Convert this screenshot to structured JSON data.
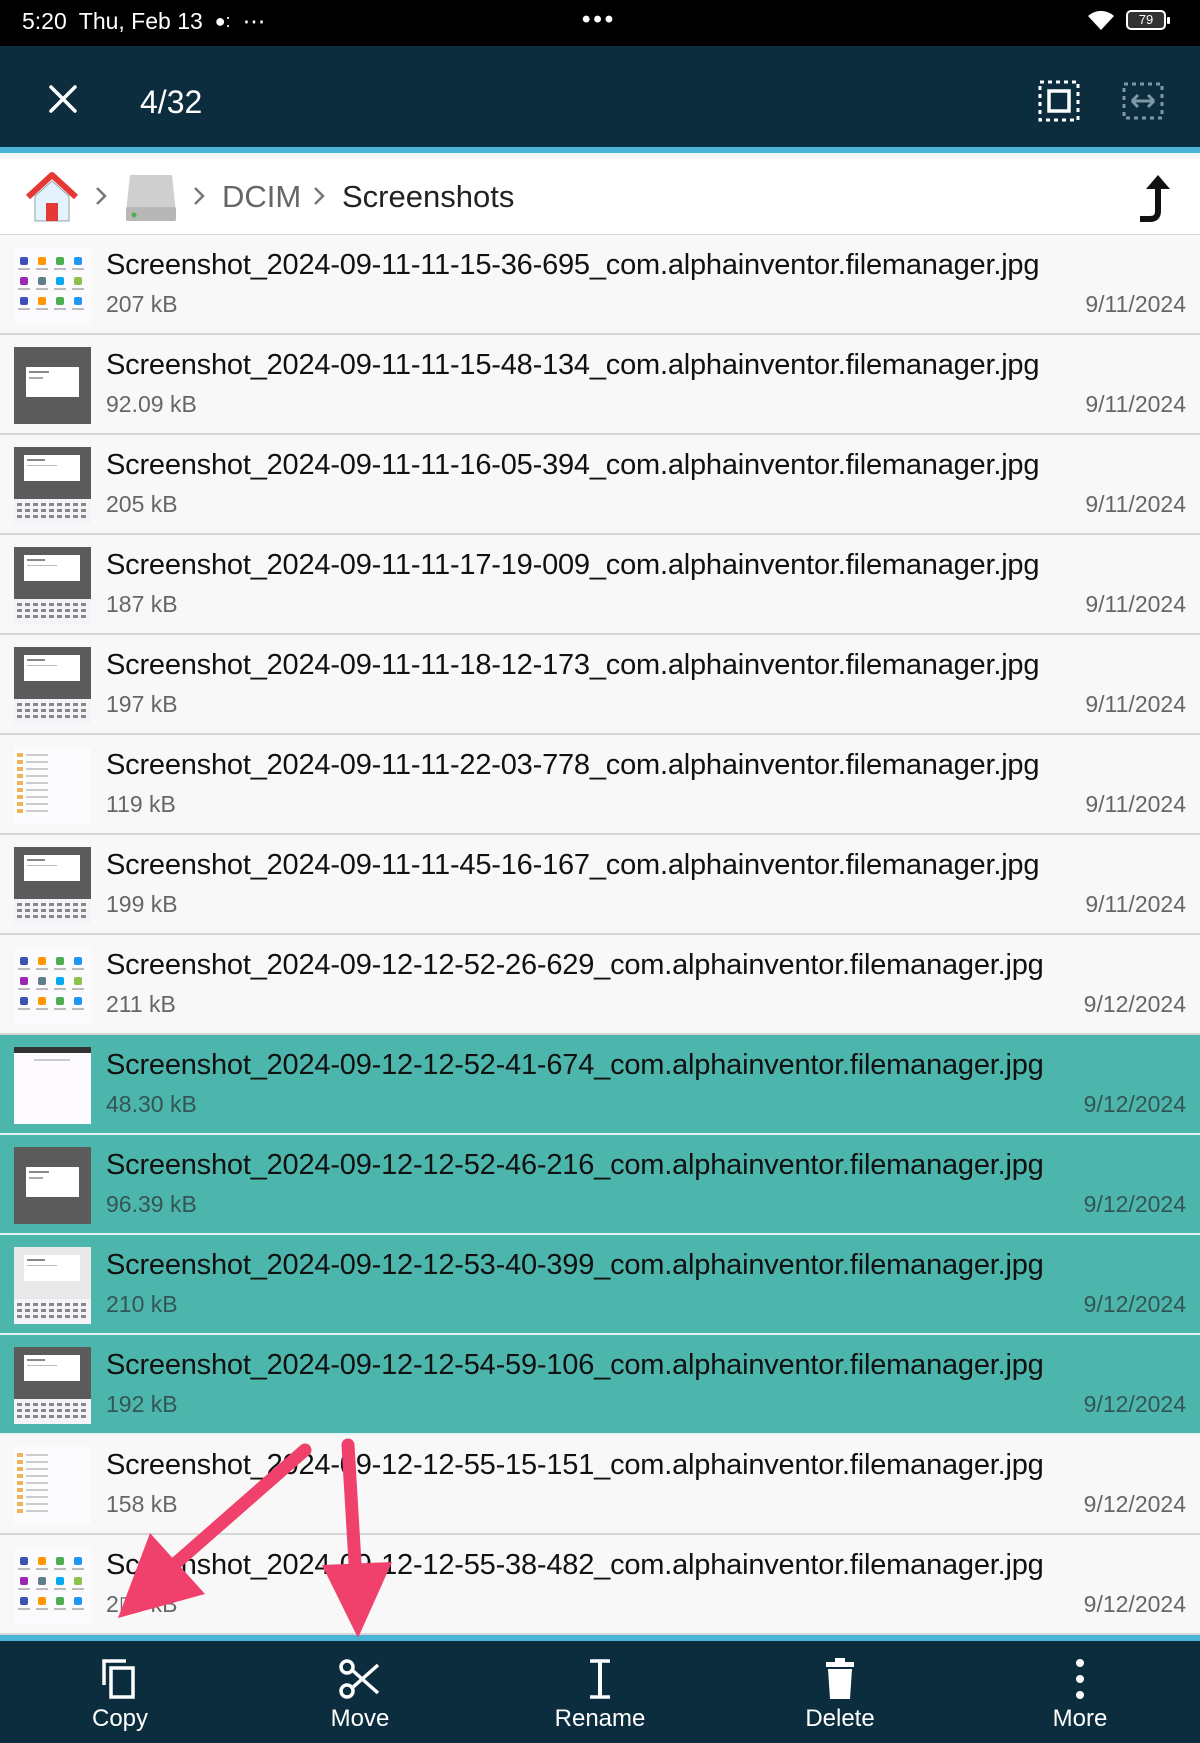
{
  "status_bar": {
    "time": "5:20",
    "date": "Thu, Feb 13",
    "extra": "⋯",
    "center_dots": "•••",
    "battery": "79"
  },
  "toolbar": {
    "selection_count": "4/32",
    "close_icon": "close-icon",
    "select_all_icon": "select-all-icon",
    "select_range_icon": "select-range-icon"
  },
  "breadcrumb": {
    "home_icon": "home-icon",
    "storage_icon": "storage-icon",
    "folder1": "DCIM",
    "folder2": "Screenshots",
    "up_icon": "up-arrow-icon"
  },
  "files": [
    {
      "name": "Screenshot_2024-09-11-11-15-36-695_com.alphainventor.filemanager.jpg",
      "size": "207 kB",
      "date": "9/11/2024",
      "selected": false,
      "thumb": "grid"
    },
    {
      "name": "Screenshot_2024-09-11-11-15-48-134_com.alphainventor.filemanager.jpg",
      "size": "92.09 kB",
      "date": "9/11/2024",
      "selected": false,
      "thumb": "dialog"
    },
    {
      "name": "Screenshot_2024-09-11-11-16-05-394_com.alphainventor.filemanager.jpg",
      "size": "205 kB",
      "date": "9/11/2024",
      "selected": false,
      "thumb": "keyboard"
    },
    {
      "name": "Screenshot_2024-09-11-11-17-19-009_com.alphainventor.filemanager.jpg",
      "size": "187 kB",
      "date": "9/11/2024",
      "selected": false,
      "thumb": "keyboard"
    },
    {
      "name": "Screenshot_2024-09-11-11-18-12-173_com.alphainventor.filemanager.jpg",
      "size": "197 kB",
      "date": "9/11/2024",
      "selected": false,
      "thumb": "keyboard"
    },
    {
      "name": "Screenshot_2024-09-11-11-22-03-778_com.alphainventor.filemanager.jpg",
      "size": "119 kB",
      "date": "9/11/2024",
      "selected": false,
      "thumb": "list"
    },
    {
      "name": "Screenshot_2024-09-11-11-45-16-167_com.alphainventor.filemanager.jpg",
      "size": "199 kB",
      "date": "9/11/2024",
      "selected": false,
      "thumb": "keyboard"
    },
    {
      "name": "Screenshot_2024-09-12-12-52-26-629_com.alphainventor.filemanager.jpg",
      "size": "211 kB",
      "date": "9/12/2024",
      "selected": false,
      "thumb": "grid"
    },
    {
      "name": "Screenshot_2024-09-12-12-52-41-674_com.alphainventor.filemanager.jpg",
      "size": "48.30 kB",
      "date": "9/12/2024",
      "selected": true,
      "thumb": "blank"
    },
    {
      "name": "Screenshot_2024-09-12-12-52-46-216_com.alphainventor.filemanager.jpg",
      "size": "96.39 kB",
      "date": "9/12/2024",
      "selected": true,
      "thumb": "dialog"
    },
    {
      "name": "Screenshot_2024-09-12-12-53-40-399_com.alphainventor.filemanager.jpg",
      "size": "210 kB",
      "date": "9/12/2024",
      "selected": true,
      "thumb": "keyboard-light"
    },
    {
      "name": "Screenshot_2024-09-12-12-54-59-106_com.alphainventor.filemanager.jpg",
      "size": "192 kB",
      "date": "9/12/2024",
      "selected": true,
      "thumb": "keyboard"
    },
    {
      "name": "Screenshot_2024-09-12-12-55-15-151_com.alphainventor.filemanager.jpg",
      "size": "158 kB",
      "date": "9/12/2024",
      "selected": false,
      "thumb": "list"
    },
    {
      "name": "Screenshot_2024-09-12-12-55-38-482_com.alphainventor.filemanager.jpg",
      "size": "2▯9 kB",
      "date": "9/12/2024",
      "selected": false,
      "thumb": "grid"
    }
  ],
  "actions": [
    {
      "label": "Copy",
      "icon": "copy-icon"
    },
    {
      "label": "Move",
      "icon": "scissors-icon"
    },
    {
      "label": "Rename",
      "icon": "text-cursor-icon"
    },
    {
      "label": "Delete",
      "icon": "trash-icon"
    },
    {
      "label": "More",
      "icon": "more-vertical-icon"
    }
  ],
  "colors": {
    "toolbar_bg": "#0c2d3e",
    "accent_line": "#4bb5d8",
    "selected_row": "#4db6ac",
    "annotation_arrow": "#f0416d"
  },
  "annotations": {
    "arrows": [
      "arrow-to-copy",
      "arrow-to-move"
    ]
  }
}
